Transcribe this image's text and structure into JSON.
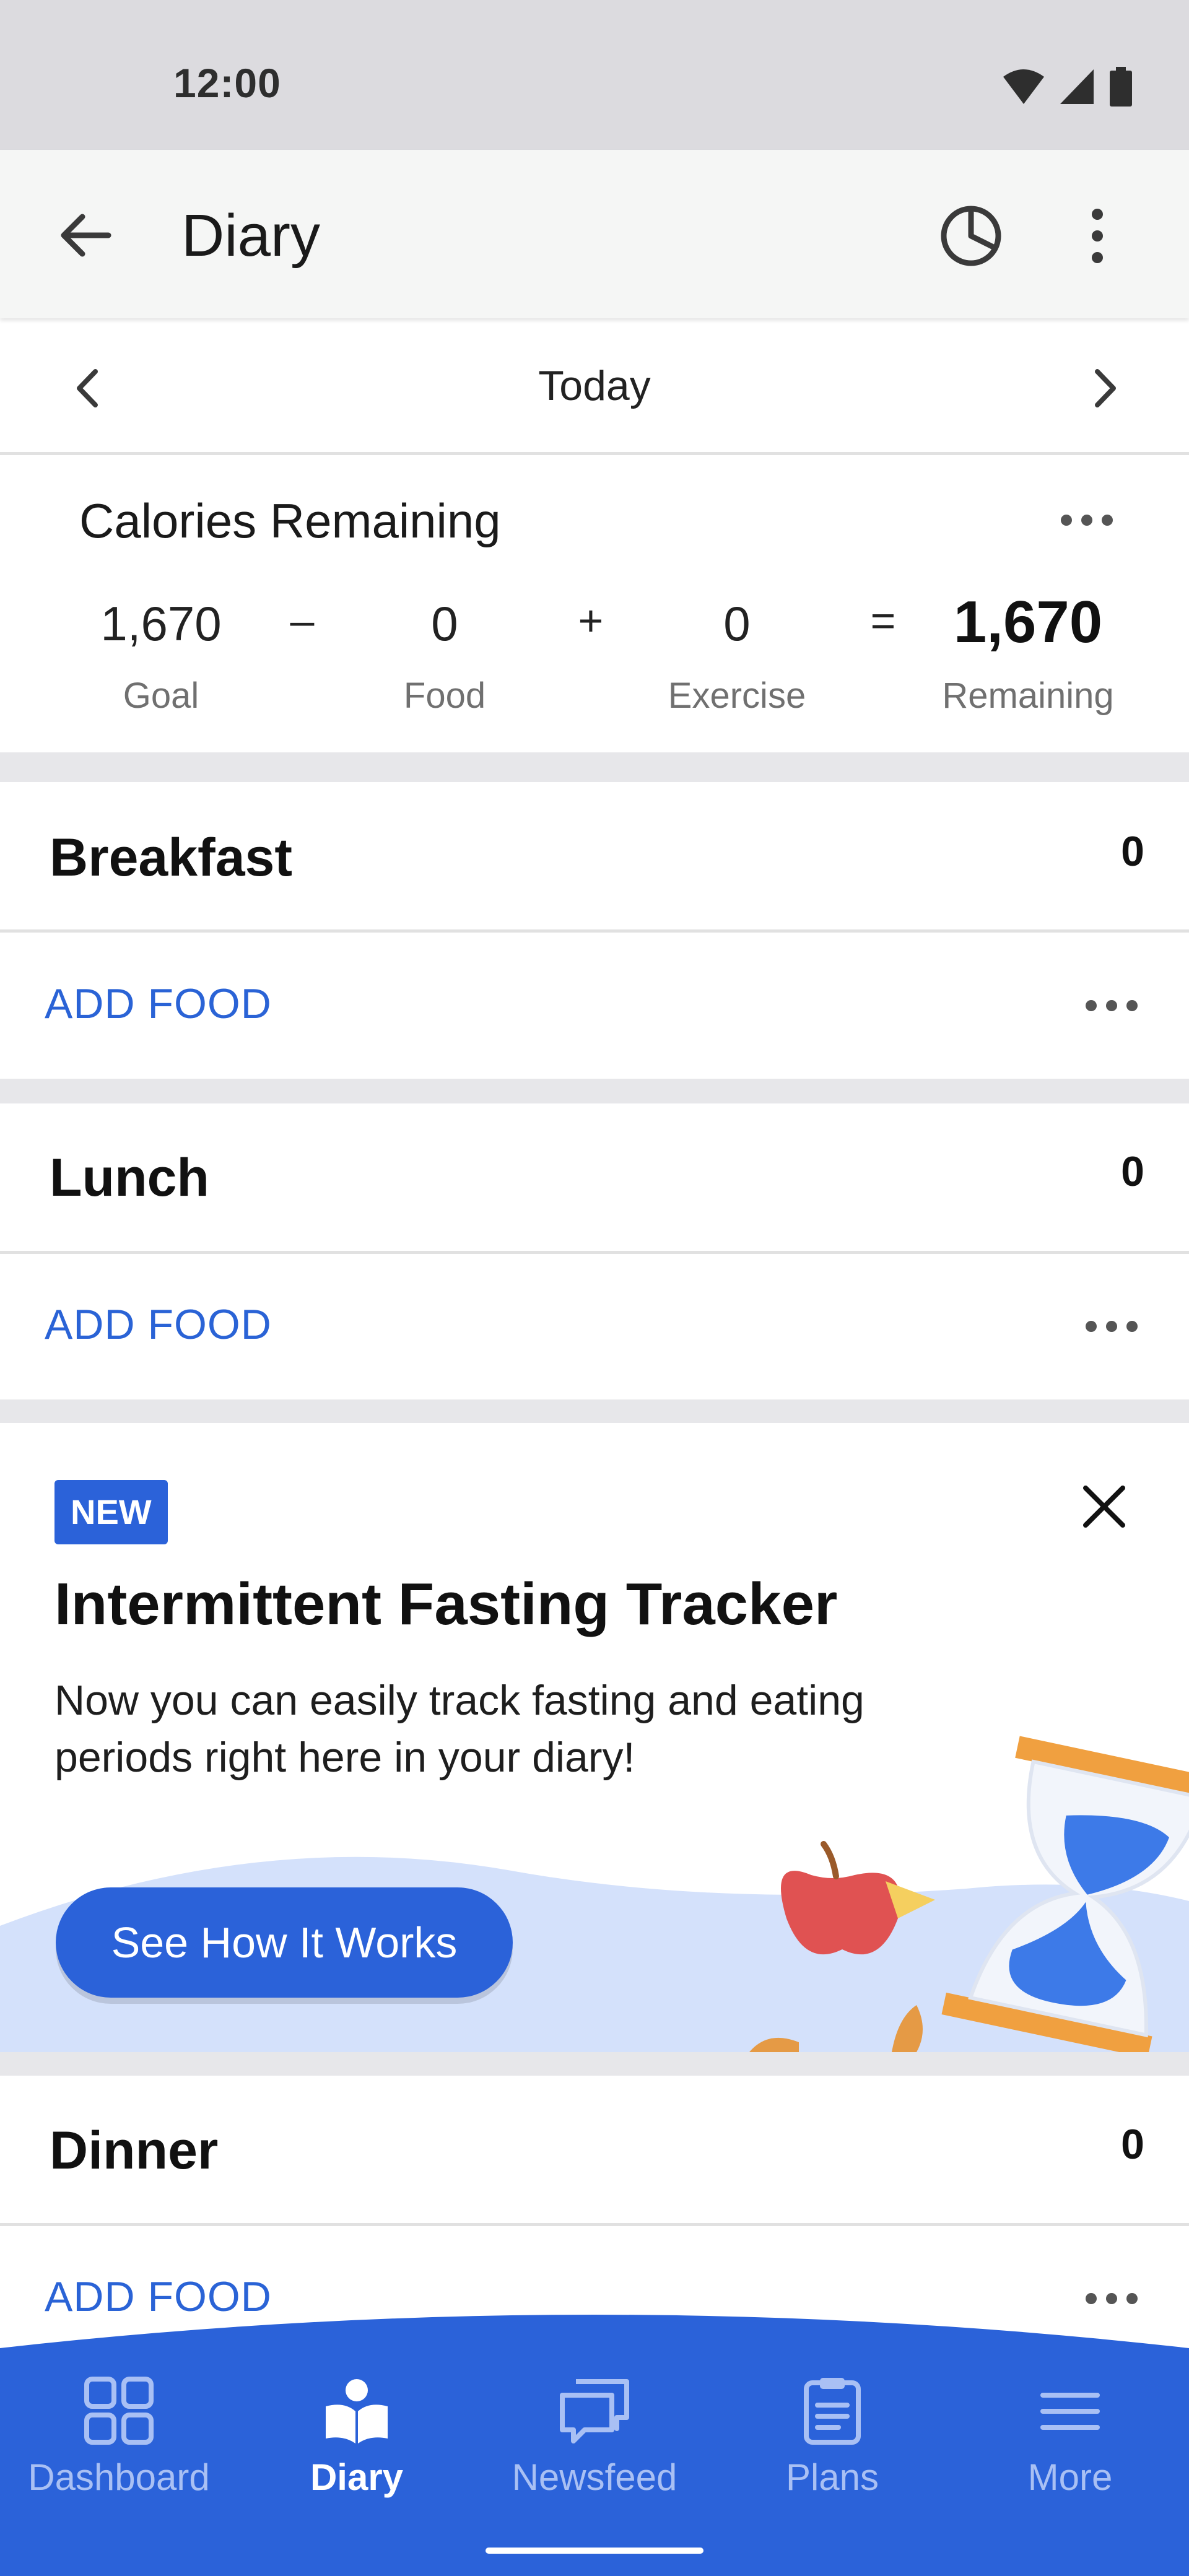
{
  "status_bar": {
    "time": "12:00"
  },
  "app_bar": {
    "title": "Diary"
  },
  "date_nav": {
    "label": "Today"
  },
  "calories": {
    "title": "Calories Remaining",
    "goal_value": "1,670",
    "goal_label": "Goal",
    "minus": "–",
    "food_value": "0",
    "food_label": "Food",
    "plus": "+",
    "exercise_value": "0",
    "exercise_label": "Exercise",
    "equals": "=",
    "remaining_value": "1,670",
    "remaining_label": "Remaining"
  },
  "meals": [
    {
      "title": "Breakfast",
      "count": "0",
      "add_label": "ADD FOOD"
    },
    {
      "title": "Lunch",
      "count": "0",
      "add_label": "ADD FOOD"
    },
    {
      "title": "Dinner",
      "count": "0",
      "add_label": "ADD FOOD"
    }
  ],
  "promo": {
    "badge": "NEW",
    "title": "Intermittent Fasting Tracker",
    "description": "Now you can easily track fasting and eating periods right here in your diary!",
    "button": "See How It Works"
  },
  "bottom_nav": {
    "items": [
      {
        "label": "Dashboard",
        "icon": "dashboard-icon",
        "active": false
      },
      {
        "label": "Diary",
        "icon": "diary-icon",
        "active": true
      },
      {
        "label": "Newsfeed",
        "icon": "newsfeed-icon",
        "active": false
      },
      {
        "label": "Plans",
        "icon": "plans-icon",
        "active": false
      },
      {
        "label": "More",
        "icon": "more-menu-icon",
        "active": false
      }
    ]
  },
  "colors": {
    "accent": "#2b62d9",
    "status_bar_bg": "#dcdbdf",
    "app_bar_bg": "#f5f6f5",
    "nav_inactive": "#a9c0f4"
  }
}
